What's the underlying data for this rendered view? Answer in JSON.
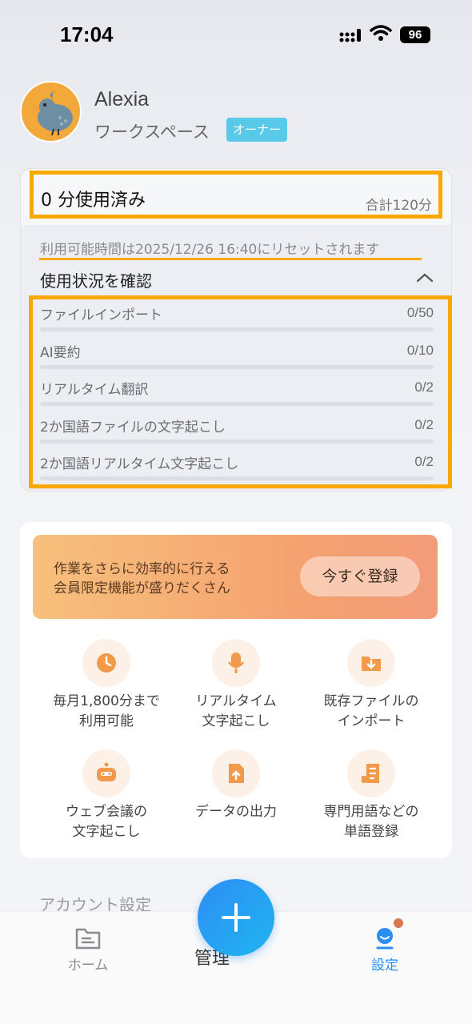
{
  "status_bar": {
    "time": "17:04",
    "battery": "96"
  },
  "profile": {
    "name": "Alexia",
    "workspace": "ワークスペース",
    "role_badge": "オーナー"
  },
  "usage": {
    "used": "0 分使用済み",
    "total": "合計120分",
    "reset_notice": "利用可能時間は2025/12/26 16:40にリセットされます",
    "check_label": "使用状況を確認",
    "rows": [
      {
        "label": "ファイルインポート",
        "value": "0/50"
      },
      {
        "label": "AI要約",
        "value": "0/10"
      },
      {
        "label": "リアルタイム翻訳",
        "value": "0/2"
      },
      {
        "label": "2か国語ファイルの文字起こし",
        "value": "0/2"
      },
      {
        "label": "2か国語リアルタイム文字起こし",
        "value": "0/2"
      }
    ]
  },
  "premium": {
    "banner_line1": "作業をさらに効率的に行える",
    "banner_line2": "会員限定機能が盛りだくさん",
    "register_button": "今すぐ登録",
    "features": [
      {
        "icon": "clock-icon",
        "line1": "毎月1,800分まで",
        "line2": "利用可能"
      },
      {
        "icon": "microphone-icon",
        "line1": "リアルタイム",
        "line2": "文字起こし"
      },
      {
        "icon": "folder-download-icon",
        "line1": "既存ファイルの",
        "line2": "インポート"
      },
      {
        "icon": "robot-icon",
        "line1": "ウェブ会議の",
        "line2": "文字起こし"
      },
      {
        "icon": "file-export-icon",
        "line1": "データの出力",
        "line2": ""
      },
      {
        "icon": "glossary-icon",
        "line1": "専門用語などの",
        "line2": "単語登録"
      }
    ]
  },
  "account_settings_label": "アカウント設定",
  "tabbar": {
    "home": "ホーム",
    "manage": "管理",
    "settings": "設定"
  },
  "colors": {
    "highlight": "#f8a800",
    "accent_blue": "#2a8ef0",
    "badge": "#59c9ea",
    "icon_orange": "#f29a4a"
  }
}
